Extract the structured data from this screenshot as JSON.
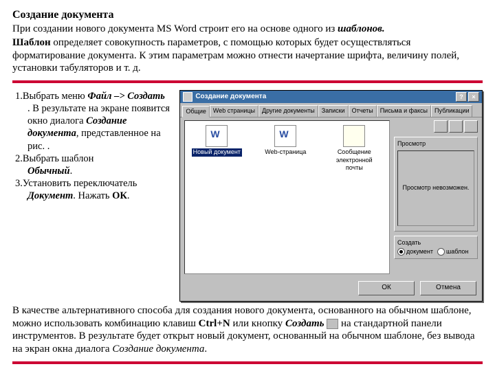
{
  "title": "Создание документа",
  "intro1": "При создании нового документа MS Word строит его на основе одного из ",
  "intro1b": "шаблонов.",
  "intro2a": "Шаблон",
  "intro2": " определяет совокупность параметров, с помощью которых будет осуществляться форматирование документа. К этим параметрам можно отнести начертание шрифта, величину полей, установки табуляторов и т. д.",
  "step1_pre": "1.Выбрать меню ",
  "step1_menu": "Файл –> Создать",
  "step1_post": ". В результате на экране появится окно диалога ",
  "step1_dlg": "Создание документа",
  "step1_fin": ", представленное на рис. .",
  "step2_pre": "2.Выбрать шаблон ",
  "step2_b": "Обычный",
  "step3_pre": "3.Установить переключатель ",
  "step3_b1": "Документ",
  "step3_mid": ". Нажать ",
  "step3_b2": "ОК",
  "bottom_a": "В качестве альтернативного способа для создания нового документа, основанного на обычном шаблоне, можно использовать комбинацию клавиш ",
  "bottom_ctrl": "Ctrl+N",
  "bottom_b": " или кнопку ",
  "bottom_create": "Создать",
  "bottom_c": " на стандартной панели инструментов. В результате будет открыт новый документ, основанный на обычном шаблоне, без вывода на экран окна диалога ",
  "bottom_dlg": "Создание документа",
  "dot": ".",
  "dlg": {
    "title": "Создание документа",
    "help": "?",
    "close": "×",
    "tabs": [
      "Общие",
      "Web страницы",
      "Другие документы",
      "Записки",
      "Отчеты",
      "Письма и факсы",
      "Публикации"
    ],
    "templates": {
      "t1": "Новый документ",
      "t2": "Web-страница",
      "t3": "Сообщение электронной почты"
    },
    "preview_group": "Просмотр",
    "preview_text": "Просмотр невозможен.",
    "create_group": "Создать",
    "radio_doc": "документ",
    "radio_tmpl": "шаблон",
    "ok": "ОК",
    "cancel": "Отмена"
  }
}
